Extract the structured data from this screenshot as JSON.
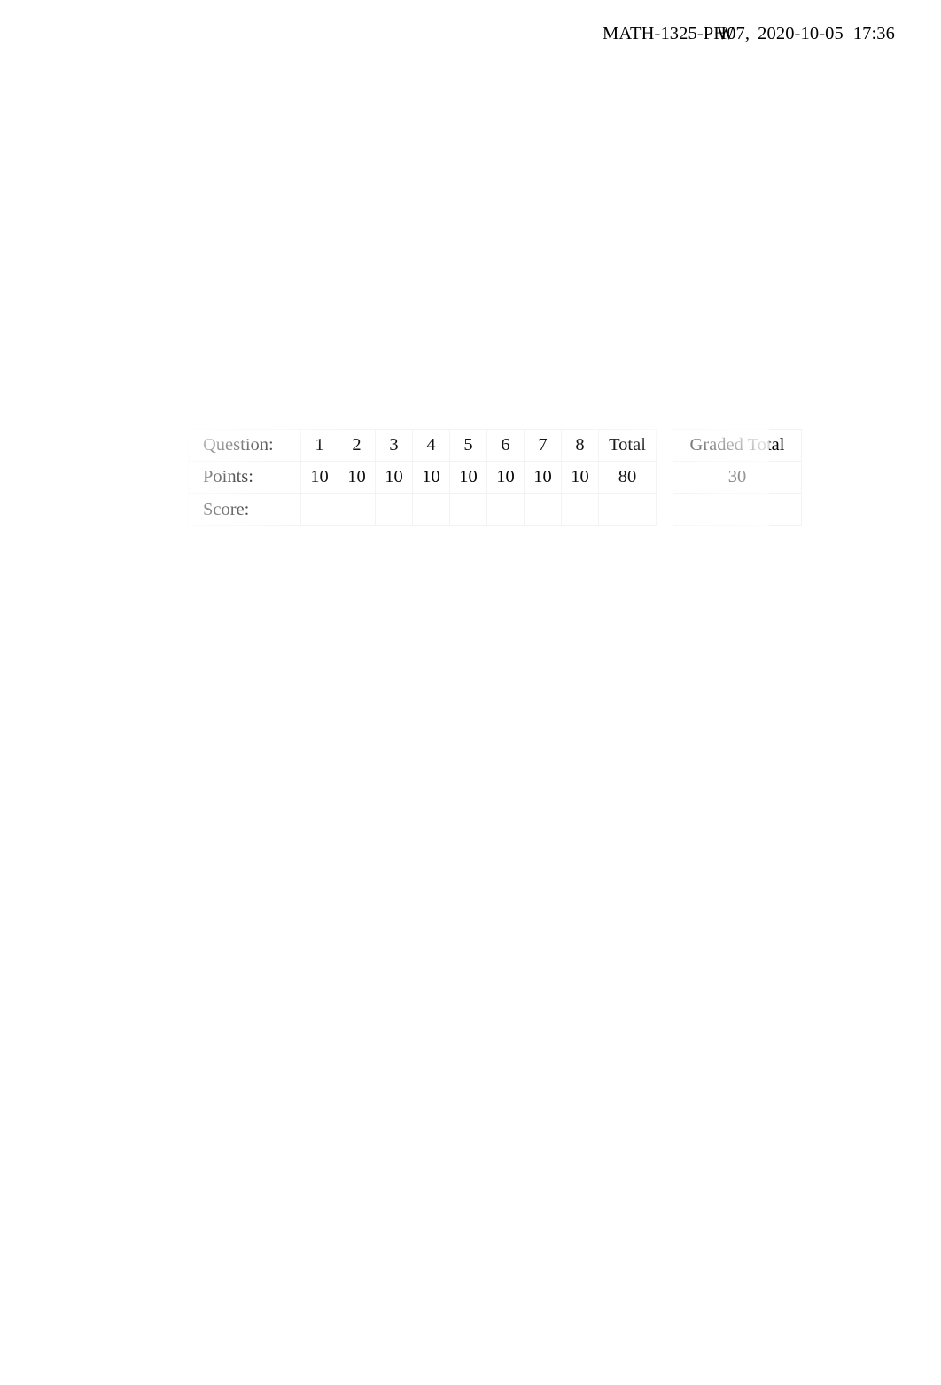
{
  "header": {
    "course_code_prefix": "MATH-1325-PH",
    "course_code_overlap_base": "W",
    "course_code_overlap_over": "07",
    "comma": ",",
    "date": "2020-10-05",
    "time": "17:36",
    "full_text": "MATH-1325-PHW07, 2020-10-05 17:36"
  },
  "grade_table": {
    "row_labels": {
      "question": "Question:",
      "points": "Points:",
      "score": "Score:"
    },
    "question_numbers": [
      "1",
      "2",
      "3",
      "4",
      "5",
      "6",
      "7",
      "8"
    ],
    "points_values": [
      "10",
      "10",
      "10",
      "10",
      "10",
      "10",
      "10",
      "10"
    ],
    "total_header": "Total",
    "total_points": "80",
    "graded_total_header": "Graded Total",
    "graded_total_points": "30",
    "score_values": [
      "",
      "",
      "",
      "",
      "",
      "",
      "",
      ""
    ],
    "total_score": "",
    "graded_total_score": "",
    "border_color": "#f2f2f2",
    "text_color": "#000000"
  }
}
